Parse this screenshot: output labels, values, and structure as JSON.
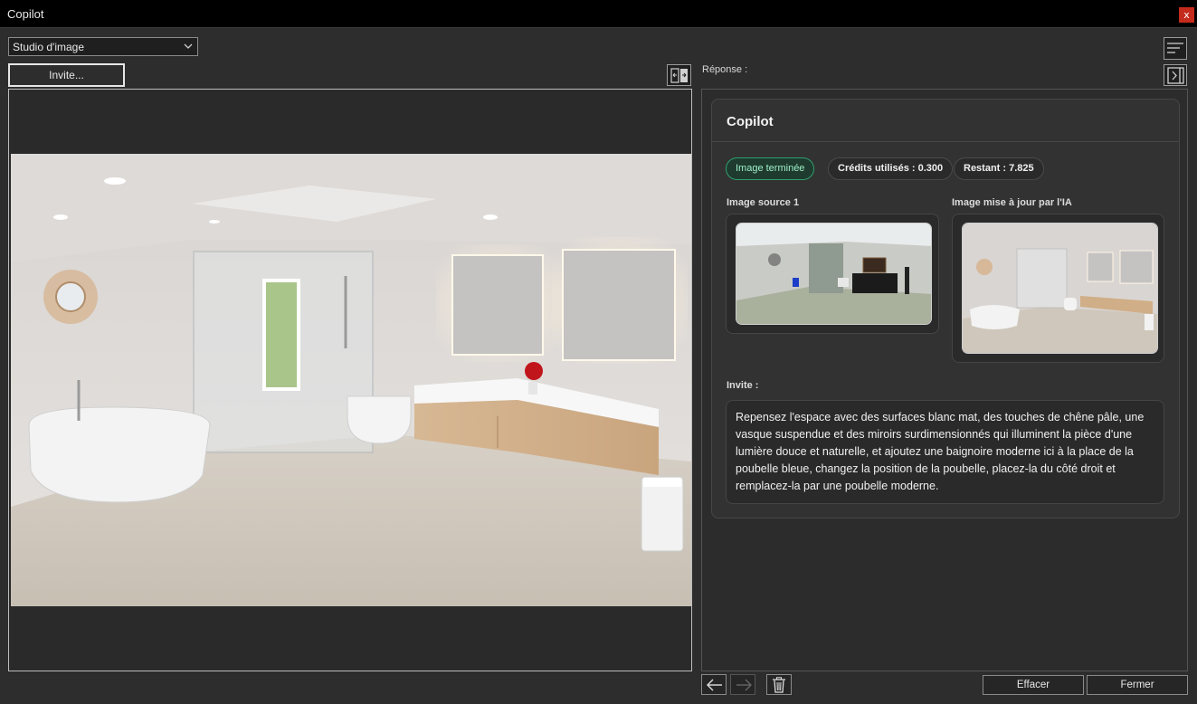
{
  "window": {
    "title": "Copilot",
    "close_label": "x"
  },
  "toolbar": {
    "mode_select": "Studio d'image",
    "invite_label": "Invite..."
  },
  "response": {
    "label": "Réponse :",
    "card_title": "Copilot",
    "status": "Image terminée",
    "credits": "Crédits utilisés : 0.300",
    "remaining": "Restant : 7.825",
    "source_label": "Image source 1",
    "updated_label": "Image mise à jour par l'IA",
    "prompt_label": "Invite :",
    "prompt_text": "Repensez l'espace avec des surfaces blanc mat, des touches de chêne pâle, une vasque suspendue et des miroirs surdimensionnés qui illuminent la pièce d'une lumière douce et naturelle, et ajoutez une baignoire moderne ici à la place de la poubelle bleue, changez la position de la poubelle, placez-la du côté droit et remplacez-la par une poubelle moderne."
  },
  "footer": {
    "clear_label": "Effacer",
    "close_label": "Fermer"
  },
  "colors": {
    "background": "#2d2d2d",
    "titlebar": "#000000",
    "close": "#c42b1c",
    "status_green": "#2f9f6f"
  },
  "icons": {
    "dropdown": "chevron-down-icon",
    "swap": "swap-panels-icon",
    "menu": "menu-lines-icon",
    "collapse": "collapse-panel-icon",
    "prev": "arrow-left-icon",
    "next": "arrow-right-icon",
    "trash": "trash-icon"
  }
}
